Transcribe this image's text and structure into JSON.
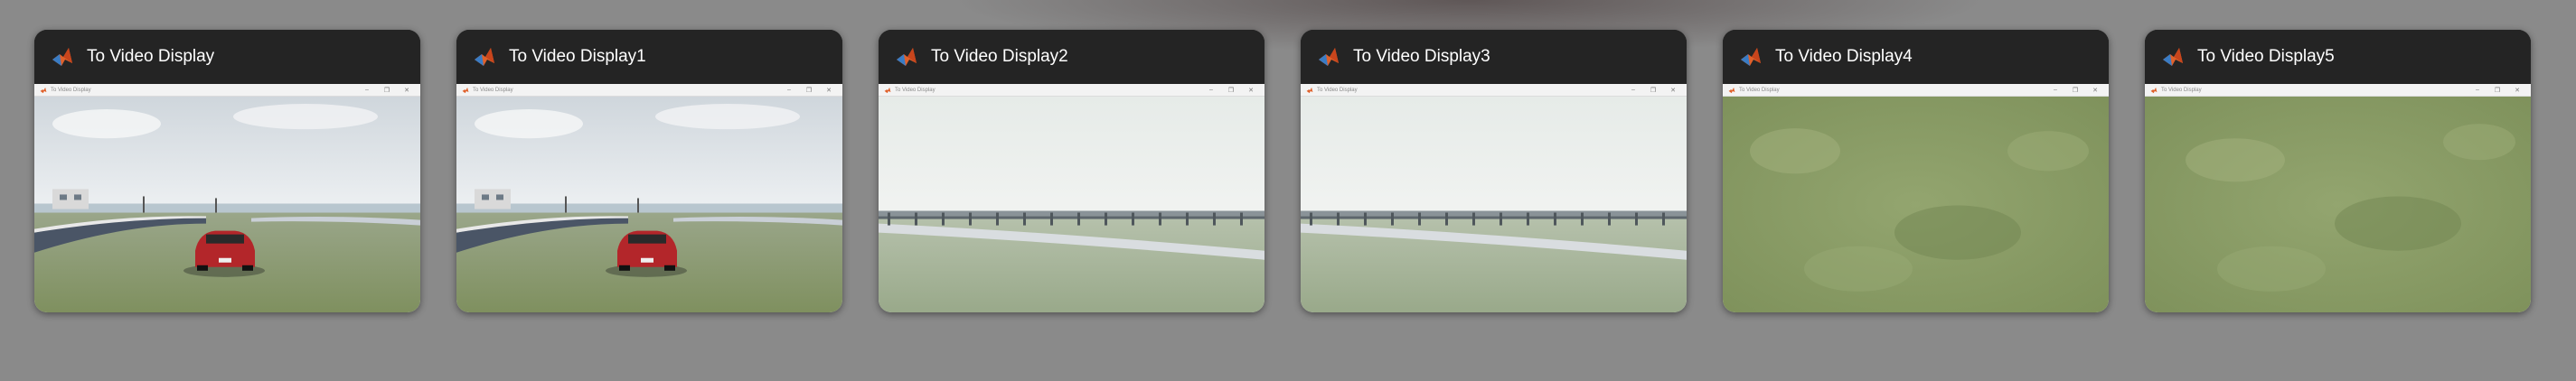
{
  "windows": [
    {
      "title": "To Video Display",
      "scene": "car-road"
    },
    {
      "title": "To Video Display1",
      "scene": "car-road"
    },
    {
      "title": "To Video Display2",
      "scene": "guardrail"
    },
    {
      "title": "To Video Display3",
      "scene": "guardrail"
    },
    {
      "title": "To Video Display4",
      "scene": "grass"
    },
    {
      "title": "To Video Display5",
      "scene": "grass"
    }
  ],
  "mini_window": {
    "title": "To Video Display",
    "minimize": "–",
    "maximize": "❐",
    "close": "✕"
  },
  "app_icon": "matlab-icon",
  "colors": {
    "background": "#8a8a8a",
    "card_header": "#242424",
    "card_title_text": "#ffffff",
    "grass": "#8d9e6d",
    "sky": "#e8ecef",
    "car": "#b3262a"
  }
}
